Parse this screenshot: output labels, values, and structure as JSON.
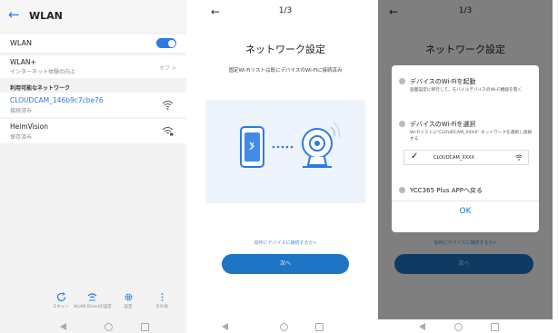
{
  "panel1": {
    "header": {
      "back_icon": "back-arrow-icon",
      "title": "WLAN"
    },
    "wlan_toggle": {
      "label": "WLAN",
      "state": "on",
      "color": "#2c7ae8"
    },
    "wlan_plus": {
      "title": "WLAN+",
      "subtitle": "インターネット体験の向上",
      "value": "オフ >"
    },
    "section_label": "利用可能なネットワーク",
    "networks": [
      {
        "name": "CLOUDCAM_146b9c7cbe76",
        "status": "接続済み",
        "active": true,
        "icon": "wifi-icon"
      },
      {
        "name": "HeimVision",
        "status": "保存済み",
        "active": false,
        "icon": "wifi-lock-icon"
      }
    ],
    "bottom_bar": [
      {
        "icon": "scan-icon",
        "label": "スキャン"
      },
      {
        "icon": "wifi-direct-icon",
        "label": "WLAN Directの設定"
      },
      {
        "icon": "gear-icon",
        "label": "設定"
      },
      {
        "icon": "more-icon",
        "label": "その他"
      }
    ]
  },
  "panel2": {
    "back_icon": "back-arrow-icon",
    "step": "1/3",
    "title": "ネットワーク設定",
    "subtitle": "固定Wi-Fiリストは既にデバイスのWi-Fiに接続済み",
    "help_link": "如何にデバイスに接続するか>",
    "next_button": "次へ"
  },
  "panel3": {
    "back_icon": "back-arrow-icon",
    "step": "1/3",
    "title": "ネットワーク設定",
    "help_link": "如何にデバイスに接続するか>",
    "next_button": "次へ",
    "dialog": {
      "steps": [
        {
          "title": "デバイスのWi-Fiを起動",
          "desc": "画面設定に移行して、モバイルデバイスのWi-Fi機能を開く"
        },
        {
          "title": "デバイスのWi-Fiを選択",
          "desc": "Wi-Fiリストに\"CLOUDCAM_XXXX\" ネットワークを選択し接続する"
        },
        {
          "title": "YCC365 Plus APPへ戻る",
          "desc": ""
        }
      ],
      "wifi_example": "CLOUDCAM_XXXX",
      "ok_button": "OK"
    }
  }
}
